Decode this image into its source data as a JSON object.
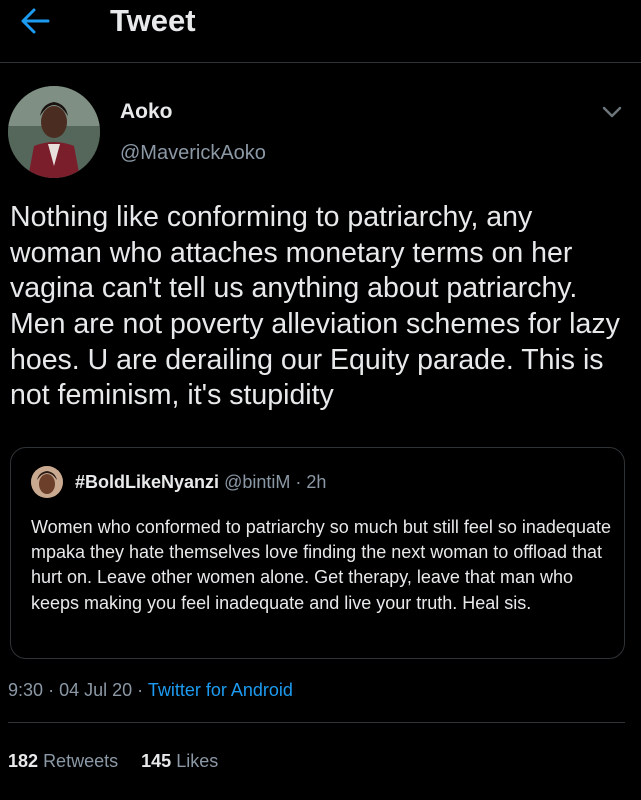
{
  "header": {
    "title": "Tweet"
  },
  "author": {
    "name": "Aoko",
    "handle": "@MaverickAoko"
  },
  "tweet": {
    "text": "Nothing like conforming to patriarchy, any woman who attaches monetary terms on her vagina can't tell us anything about patriarchy. Men are not poverty alleviation schemes for lazy hoes. U are derailing our Equity parade. This is not feminism, it's stupidity"
  },
  "quoted": {
    "name": "#BoldLikeNyanzi",
    "handle": "@bintiM",
    "separator": "·",
    "time": "2h",
    "text": "Women who conformed to patriarchy so much but still feel so inadequate mpaka they hate themselves love finding the next woman to offload that hurt on. Leave other women alone. Get therapy, leave that man who keeps making you feel inadequate and live your truth. Heal sis."
  },
  "meta": {
    "time": "9:30",
    "separator": "·",
    "date": "04 Jul 20",
    "source": "Twitter for Android"
  },
  "stats": {
    "retweets_count": "182",
    "retweets_label": "Retweets",
    "likes_count": "145",
    "likes_label": "Likes"
  },
  "colors": {
    "accent": "#1d9bf0",
    "background": "#000000",
    "muted": "#8b98a5"
  }
}
